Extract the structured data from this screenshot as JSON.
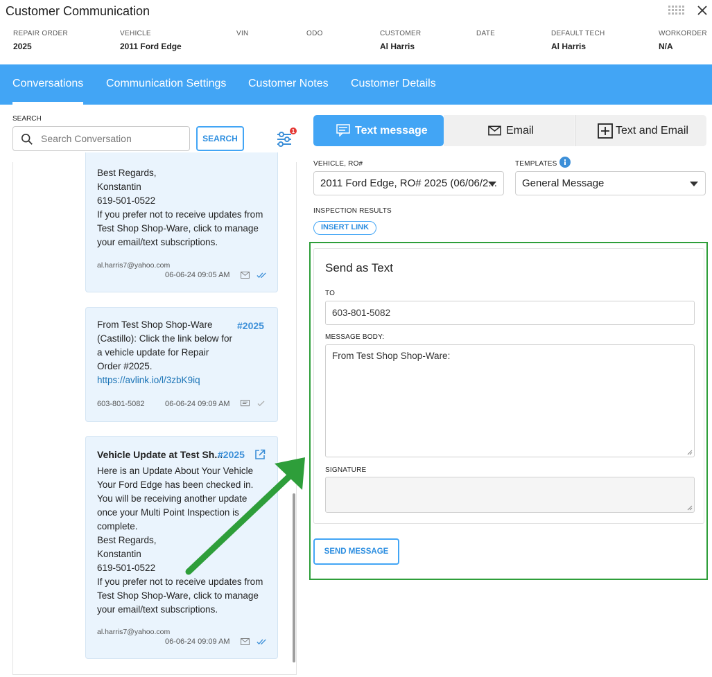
{
  "window": {
    "title": "Customer Communication"
  },
  "meta": [
    {
      "label": "REPAIR ORDER",
      "value": "2025"
    },
    {
      "label": "VEHICLE",
      "value": "2011 Ford Edge"
    },
    {
      "label": "VIN",
      "value": ""
    },
    {
      "label": "ODO",
      "value": ""
    },
    {
      "label": "CUSTOMER",
      "value": "Al Harris"
    },
    {
      "label": "DATE",
      "value": ""
    },
    {
      "label": "DEFAULT TECH",
      "value": "Al Harris"
    },
    {
      "label": "WORKORDER",
      "value": "N/A"
    }
  ],
  "tabs": [
    {
      "label": "Conversations",
      "active": true
    },
    {
      "label": "Communication Settings"
    },
    {
      "label": "Customer Notes"
    },
    {
      "label": "Customer Details"
    }
  ],
  "search": {
    "label": "SEARCH",
    "placeholder": "Search Conversation",
    "button": "SEARCH",
    "filter_badge": "1"
  },
  "conversations": [
    {
      "body": "Best Regards,\nKonstantin\n619-501-0522\nIf you prefer not to receive updates from Test Shop Shop-Ware, click to manage your email/text subscriptions.",
      "contact": "al.harris7@yahoo.com",
      "timestamp": "06-06-24 09:05 AM"
    },
    {
      "body": "From Test Shop Shop-Ware (Castillo): Click the link below for a vehicle update for Repair Order #2025.",
      "link": "https://avlink.io/l/3zbK9iq",
      "tag": "#2025",
      "contact": "603-801-5082",
      "timestamp": "06-06-24 09:09 AM"
    },
    {
      "title": "Vehicle Update at Test Sh...",
      "tag": "#2025",
      "body": "Here is an Update About Your Vehicle\nYour Ford Edge has been checked in. You will be receiving another update once your Multi Point Inspection is complete.\nBest Regards,\nKonstantin\n619-501-0522\nIf you prefer not to receive updates from Test Shop Shop-Ware, click to manage your email/text subscriptions.",
      "contact": "al.harris7@yahoo.com",
      "timestamp": "06-06-24 09:09 AM"
    }
  ],
  "compose": {
    "modes": [
      {
        "label": "Text message",
        "active": true
      },
      {
        "label": "Email"
      },
      {
        "label": "Text and Email"
      }
    ],
    "vehicle_label": "VEHICLE, RO#",
    "vehicle_value": "2011 Ford Edge, RO# 2025 (06/06/2...",
    "templates_label": "TEMPLATES",
    "templates_value": "General Message",
    "inspection_label": "INSPECTION RESULTS",
    "insert_link": "INSERT LINK",
    "panel_title": "Send as Text",
    "to_label": "TO",
    "to_value": "603-801-5082",
    "body_label": "MESSAGE BODY:",
    "body_value": "From Test Shop Shop-Ware:",
    "signature_label": "SIGNATURE",
    "signature_value": "",
    "send_button": "SEND MESSAGE"
  },
  "colors": {
    "accent": "#42a5f5",
    "highlight": "#2e9e3a",
    "card_bg": "#eaf4fd",
    "badge": "#e53935"
  }
}
